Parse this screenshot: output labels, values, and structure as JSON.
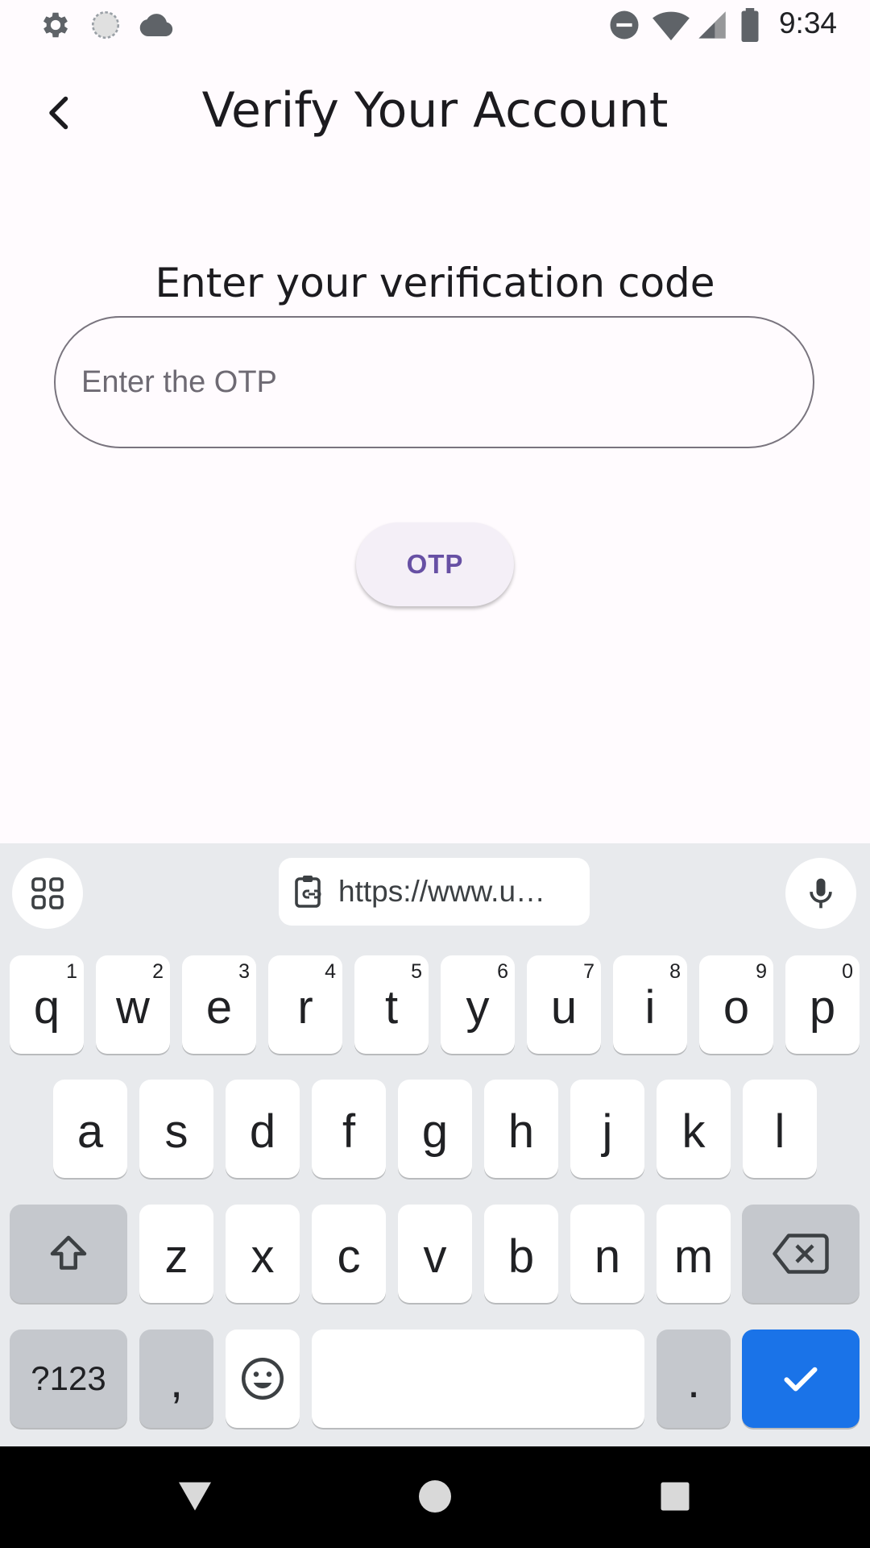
{
  "status_bar": {
    "time": "9:34",
    "left_icons": [
      "gear-icon",
      "sync-icon",
      "cloud-icon"
    ],
    "right_icons": [
      "do-not-disturb-icon",
      "wifi-icon",
      "signal-icon",
      "battery-icon"
    ]
  },
  "app_bar": {
    "title": "Verify Your Account",
    "back_icon": "chevron-left-icon"
  },
  "main": {
    "prompt": "Enter your verification code",
    "otp_input": {
      "value": "",
      "placeholder": "Enter the OTP"
    },
    "otp_button_label": "OTP"
  },
  "keyboard": {
    "clipboard_chip": "https://www.u…",
    "row1": [
      {
        "letter": "q",
        "hint": "1"
      },
      {
        "letter": "w",
        "hint": "2"
      },
      {
        "letter": "e",
        "hint": "3"
      },
      {
        "letter": "r",
        "hint": "4"
      },
      {
        "letter": "t",
        "hint": "5"
      },
      {
        "letter": "y",
        "hint": "6"
      },
      {
        "letter": "u",
        "hint": "7"
      },
      {
        "letter": "i",
        "hint": "8"
      },
      {
        "letter": "o",
        "hint": "9"
      },
      {
        "letter": "p",
        "hint": "0"
      }
    ],
    "row2": [
      "a",
      "s",
      "d",
      "f",
      "g",
      "h",
      "j",
      "k",
      "l"
    ],
    "row3": [
      "z",
      "x",
      "c",
      "v",
      "b",
      "n",
      "m"
    ],
    "symbols_label": "?123",
    "comma_label": ",",
    "period_label": "."
  },
  "colors": {
    "accent": "#6750a4",
    "keyboard_enter": "#1a73e8",
    "background": "#fffbfe"
  }
}
